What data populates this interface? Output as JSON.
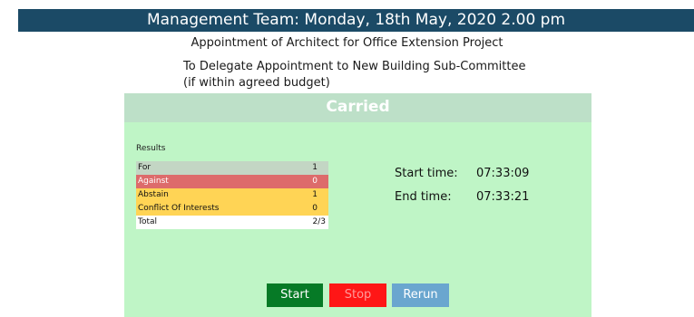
{
  "header": {
    "title": "Management Team: Monday, 18th May, 2020 2.00 pm"
  },
  "meeting": {
    "item": "Appointment of Architect for Office Extension Project",
    "proposal_line1": "To Delegate Appointment to New Building Sub-Committee",
    "proposal_line2": "(if within agreed budget)"
  },
  "panel": {
    "status": "Carried",
    "results_title": "Results",
    "results": [
      {
        "label": "For",
        "value": "1",
        "color": "#c3d6c4"
      },
      {
        "label": "Against",
        "value": "0",
        "color": "#dd6b6b"
      },
      {
        "label": "Abstain",
        "value": "1",
        "color": "#ffd455"
      },
      {
        "label": "Conflict Of Interests",
        "value": "0",
        "color": "#ffd455"
      },
      {
        "label": "Total",
        "value": "2/3",
        "color": "#ffffff"
      }
    ],
    "start_label": "Start time:",
    "start_value": "07:33:09",
    "end_label": "End time:",
    "end_value": "07:33:21"
  },
  "buttons": {
    "start": "Start",
    "stop": "Stop",
    "rerun": "Rerun"
  },
  "colors": {
    "title_bar": "#1b4a66",
    "panel_bg": "#bff5c6",
    "start_button": "#067a26",
    "stop_button": "#ff1616",
    "rerun_button": "#6aa6cf"
  }
}
